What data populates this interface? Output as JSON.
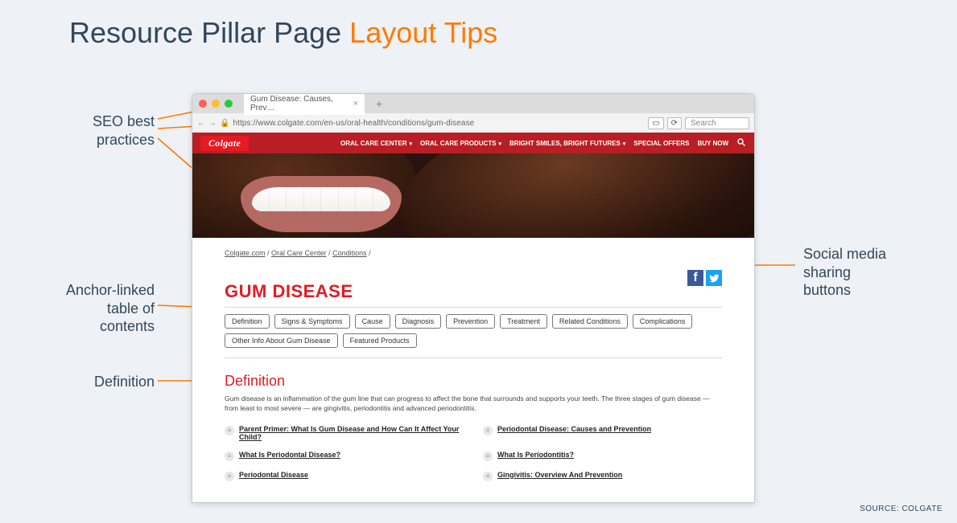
{
  "slide": {
    "title_part1": "Resource Pillar Page ",
    "title_part2": "Layout Tips",
    "source": "SOURCE: COLGATE"
  },
  "annotations": {
    "seo": "SEO best\npractices",
    "toc": "Anchor-linked\ntable of\ncontents",
    "definition": "Definition",
    "social": "Social media\nsharing\nbuttons"
  },
  "browser": {
    "tab_title": "Gum Disease: Causes, Prev…",
    "url": "https://www.colgate.com/en-us/oral-health/conditions/gum-disease",
    "search_placeholder": "Search"
  },
  "site": {
    "logo": "Colgate",
    "nav": [
      "ORAL CARE CENTER",
      "ORAL CARE PRODUCTS",
      "BRIGHT SMILES, BRIGHT FUTURES",
      "SPECIAL OFFERS",
      "BUY NOW"
    ],
    "nav_has_caret": [
      true,
      true,
      true,
      false,
      false
    ]
  },
  "page": {
    "breadcrumbs": [
      "Colgate.com",
      "Oral Care Center",
      "Conditions"
    ],
    "title": "GUM DISEASE",
    "pills": [
      "Definition",
      "Signs & Symptoms",
      "Cause",
      "Diagnosis",
      "Prevention",
      "Treatment",
      "Related Conditions",
      "Complications",
      "Other Info About Gum Disease",
      "Featured Products"
    ],
    "section_title": "Definition",
    "body": "Gum disease is an inflammation of the gum line that can progress to affect the bone that surrounds and supports your teeth. The three stages of gum disease — from least to most severe — are gingivitis, periodontitis and advanced periodontitis.",
    "links": [
      "Parent Primer: What Is Gum Disease and How Can It Affect Your Child?",
      "Periodontal Disease: Causes and Prevention",
      "What Is Periodontal Disease?",
      "What Is Periodontitis?",
      "Periodontal Disease",
      "Gingivitis: Overview And Prevention"
    ]
  }
}
